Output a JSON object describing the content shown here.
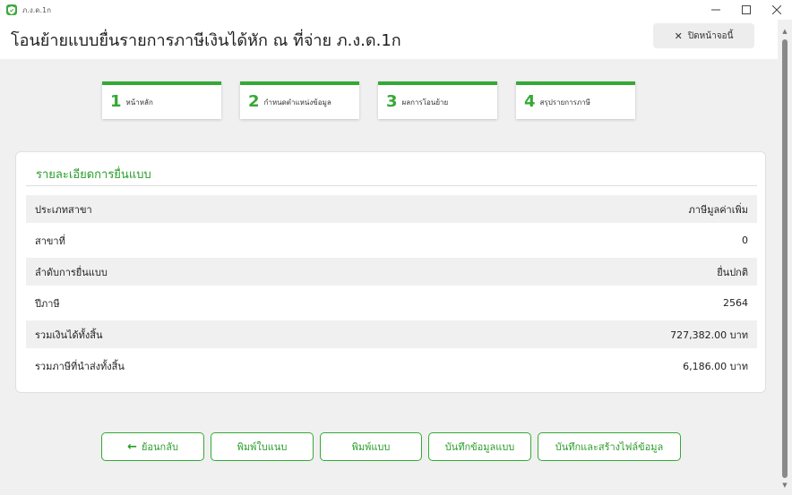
{
  "window": {
    "title": "ภ.ง.ด.1ก",
    "app_icon": "shield-icon"
  },
  "header": {
    "title": "โอนย้ายแบบยื่นรายการภาษีเงินได้หัก ณ ที่จ่าย ภ.ง.ด.1ก",
    "close_label": "ปิดหน้าจอนี้"
  },
  "steps": [
    {
      "num": "1",
      "label": "หน้าหลัก"
    },
    {
      "num": "2",
      "label": "กำหนดตำแหน่งข้อมูล"
    },
    {
      "num": "3",
      "label": "ผลการโอนย้าย"
    },
    {
      "num": "4",
      "label": "สรุปรายการภาษี"
    }
  ],
  "details": {
    "title": "รายละเอียดการยื่นแบบ",
    "rows": [
      {
        "label": "ประเภทสาขา",
        "value": "ภาษีมูลค่าเพิ่ม"
      },
      {
        "label": "สาขาที่",
        "value": "0"
      },
      {
        "label": "ลำดับการยื่นแบบ",
        "value": "ยื่นปกติ"
      },
      {
        "label": "ปีภาษี",
        "value": "2564"
      },
      {
        "label": "รวมเงินได้ทั้งสิ้น",
        "value": "727,382.00 บาท"
      },
      {
        "label": "รวมภาษีที่นำส่งทั้งสิ้น",
        "value": "6,186.00 บาท"
      }
    ]
  },
  "actions": {
    "back": "ย้อนกลับ",
    "print_cover": "พิมพ์ใบแนบ",
    "print_form": "พิมพ์แบบ",
    "save_data": "บันทึกข้อมูลแบบ",
    "save_and_create": "บันทึกและสร้างไฟล์ข้อมูล"
  },
  "colors": {
    "accent": "#35a935",
    "accent_text": "#2a9d2a",
    "background": "#f0f0f0"
  }
}
